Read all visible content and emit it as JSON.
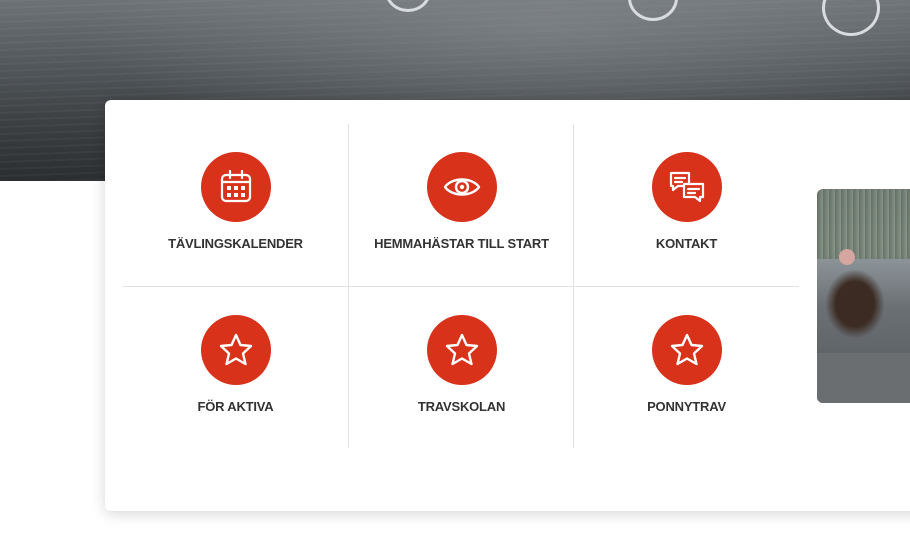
{
  "colors": {
    "accent": "#d8321b",
    "card_bg": "#ffffff",
    "label_text": "#333333",
    "divider": "#e2e2e2"
  },
  "hero": {
    "image_alt": "harness racing hero image"
  },
  "quick_links": [
    {
      "label": "TÄVLINGSKALENDER",
      "icon": "calendar-icon"
    },
    {
      "label": "HEMMAHÄSTAR TILL START",
      "icon": "eye-icon"
    },
    {
      "label": "KONTAKT",
      "icon": "chat-bubbles-icon"
    },
    {
      "label": "FÖR AKTIVA",
      "icon": "star-icon"
    },
    {
      "label": "TRAVSKOLAN",
      "icon": "star-icon"
    },
    {
      "label": "PONNYTRAV",
      "icon": "star-icon"
    }
  ],
  "side_photo": {
    "alt": "trotting race photo"
  }
}
